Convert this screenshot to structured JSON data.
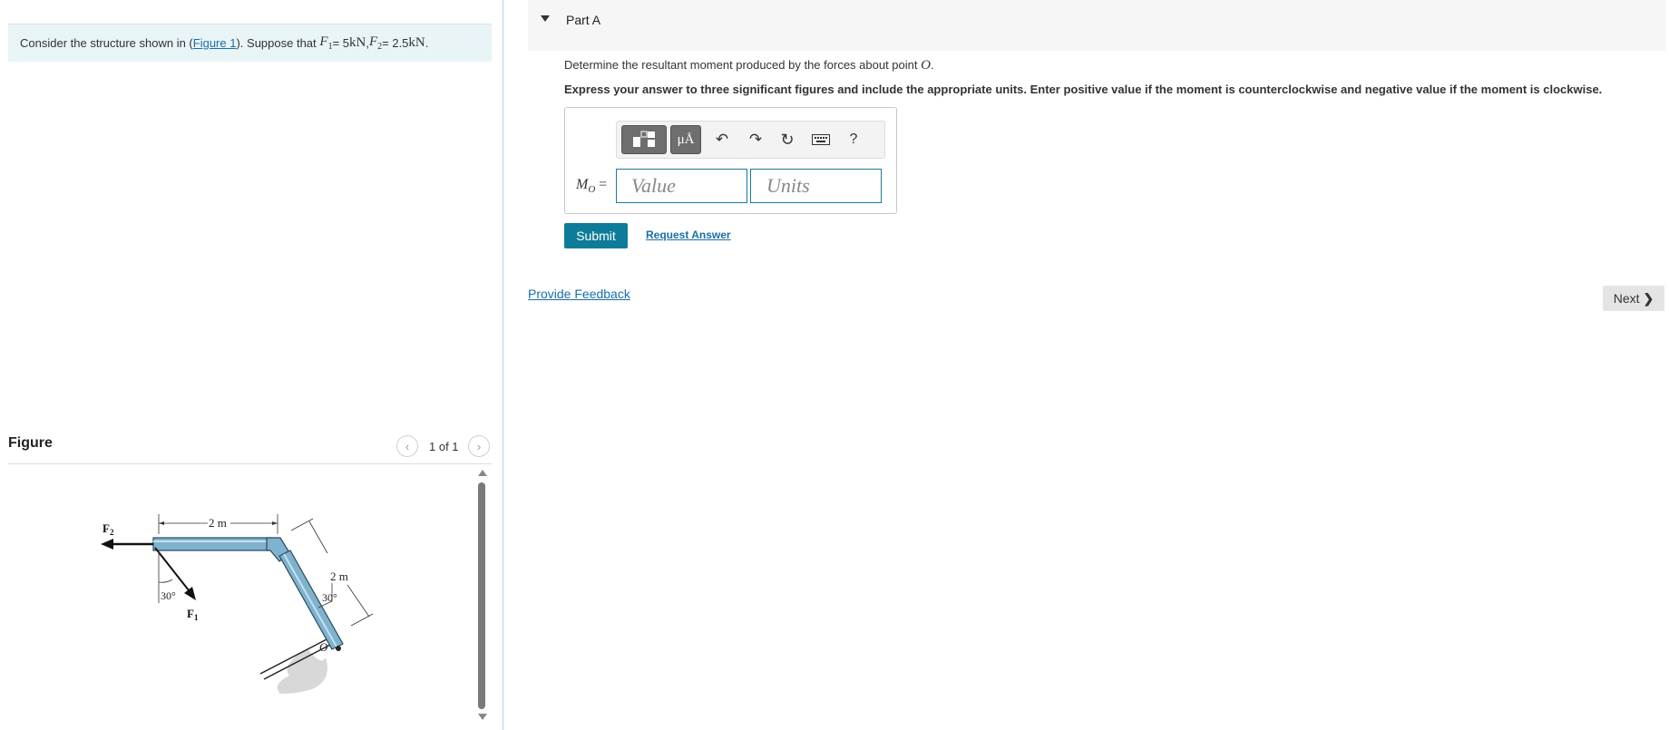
{
  "problem": {
    "text_before": "Consider the structure shown in (",
    "figure_link": "Figure 1",
    "text_after": "). Suppose that ",
    "f1_symbol": "F",
    "f1_sub": "1",
    "f1_equals": " = 5 ",
    "f1_unit": "kN",
    "separator": ", ",
    "f2_symbol": "F",
    "f2_sub": "2",
    "f2_equals": " = 2.5 ",
    "f2_unit": "kN",
    "end": "."
  },
  "figure": {
    "title": "Figure",
    "counter": "1 of 1",
    "prev_icon": "chevron-left-icon",
    "next_icon": "chevron-right-icon",
    "diagram": {
      "f2_label": "F",
      "f2_sub": "2",
      "f1_label": "F",
      "f1_sub": "1",
      "top_dim": "2 m",
      "slant_dim": "2 m",
      "angle_f1": "30°",
      "angle_o": "30°",
      "point_o": "O"
    }
  },
  "part": {
    "title": "Part A",
    "question_prefix": "Determine the resultant moment produced by the forces about point ",
    "question_point": "O",
    "question_suffix": ".",
    "instructions": "Express your answer to three significant figures and include the appropriate units. Enter positive value if the moment is counterclockwise and negative value if the moment is clockwise."
  },
  "toolbar": {
    "units_label": "μÅ",
    "undo_icon": "undo-icon",
    "redo_icon": "redo-icon",
    "reset_icon": "reset-icon",
    "keyboard_icon": "keyboard-icon",
    "help_label": "?"
  },
  "answer": {
    "label_symbol": "M",
    "label_sub": "O",
    "label_equals": " =",
    "value_placeholder": "Value",
    "units_placeholder": "Units"
  },
  "actions": {
    "submit": "Submit",
    "request_answer": "Request Answer",
    "provide_feedback": "Provide Feedback",
    "next": "Next"
  }
}
